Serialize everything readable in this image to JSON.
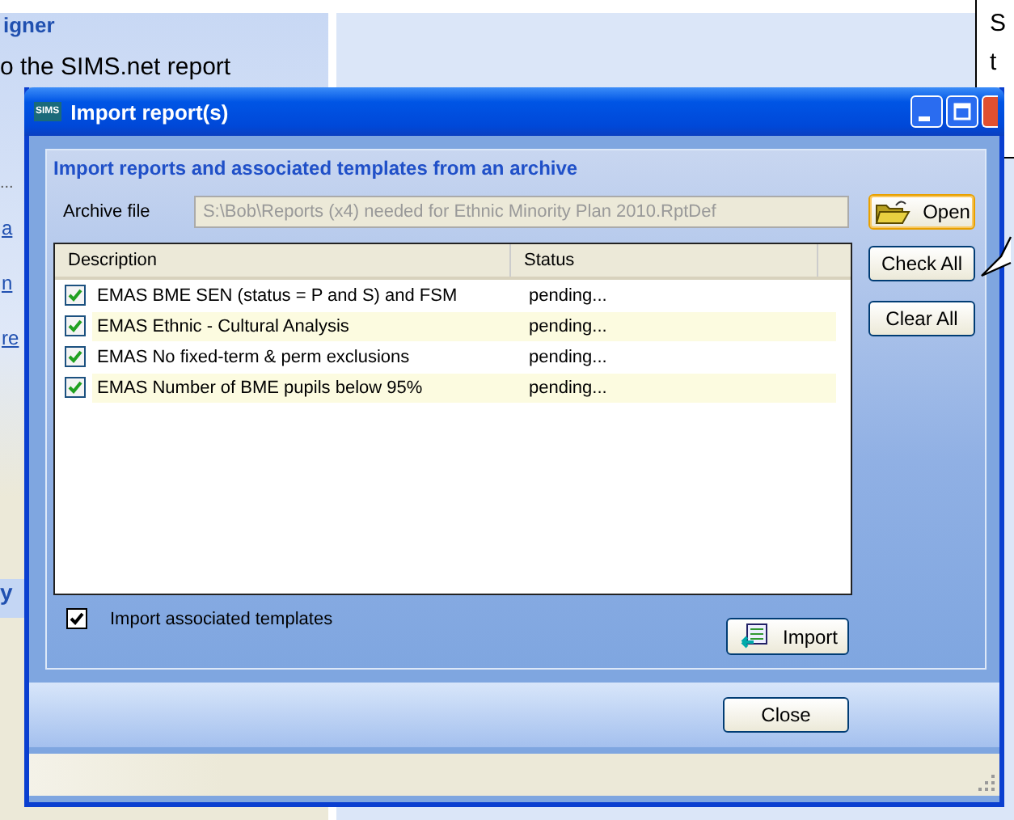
{
  "background": {
    "panel_title": "igner",
    "heading": "o the SIMS.net report",
    "ellipsis": "...",
    "links": [
      "a",
      "n",
      "re"
    ],
    "bottom_link": "y",
    "callout": [
      "S",
      "t"
    ]
  },
  "window": {
    "icon": "SIMS",
    "title": "Import report(s)"
  },
  "group": {
    "title": "Import reports and associated templates from an archive",
    "archive_label": "Archive file",
    "archive_value": "S:\\Bob\\Reports (x4) needed for Ethnic Minority Plan 2010.RptDef",
    "open_button": "Open"
  },
  "table": {
    "columns": [
      "Description",
      "Status"
    ],
    "rows": [
      {
        "description": "EMAS BME  SEN (status = P and S) and FSM",
        "status": "pending...",
        "checked": true
      },
      {
        "description": "EMAS Ethnic - Cultural Analysis",
        "status": "pending...",
        "checked": true
      },
      {
        "description": "EMAS No  fixed-term & perm exclusions",
        "status": "pending...",
        "checked": true
      },
      {
        "description": "EMAS Number of BME pupils below 95%",
        "status": "pending...",
        "checked": true
      }
    ]
  },
  "side_buttons": [
    "Check All",
    "Clear All"
  ],
  "templates_option": {
    "label": "Import associated templates",
    "checked": true
  },
  "import_button": "Import",
  "close_button": "Close"
}
